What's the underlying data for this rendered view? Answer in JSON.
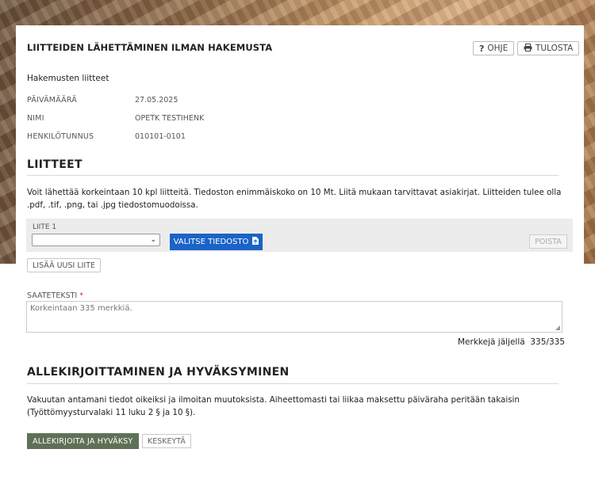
{
  "header": {
    "title": "LIITTEIDEN LÄHETTÄMINEN ILMAN HAKEMUSTA",
    "help_label": "OHJE",
    "help_icon": "?",
    "print_label": "TULOSTA"
  },
  "applicant": {
    "subheading": "Hakemusten liitteet",
    "fields": [
      {
        "label": "PÄIVÄMÄÄRÄ",
        "value": "27.05.2025"
      },
      {
        "label": "NIMI",
        "value": "OPETK TESTIHENK"
      },
      {
        "label": "HENKILÖTUNNUS",
        "value": "010101-0101"
      }
    ]
  },
  "attachments": {
    "title": "LIITTEET",
    "description": "Voit lähettää korkeintaan 10 kpl liitteitä. Tiedoston enimmäiskoko on 10 Mt. Liitä mukaan tarvittavat asiakirjat. Liitteiden tulee olla .pdf, .tif, .png, tai .jpg tiedostomuodoissa.",
    "item_label": "LIITE 1",
    "select_value": "",
    "choose_file_label": "VALITSE TIEDOSTO",
    "remove_label": "POISTA",
    "add_label": "LISÄÄ UUSI LIITE"
  },
  "cover_text": {
    "label": "SAATETEKSTI",
    "required_mark": "*",
    "placeholder": "Korkeintaan 335 merkkiä.",
    "counter_label": "Merkkejä jäljellä",
    "counter_value": "335/335"
  },
  "signing": {
    "title": "ALLEKIRJOITTAMINEN JA HYVÄKSYMINEN",
    "text": "Vakuutan antamani tiedot oikeiksi ja ilmoitan muutoksista. Aiheettomasti tai liikaa maksettu päiväraha peritään takaisin (Työttömyysturvalaki 11 luku 2 § ja 10 §).",
    "approve_label": "ALLEKIRJOITA JA HYVÄKSY",
    "cancel_label": "KESKEYTÄ"
  },
  "colors": {
    "primary_button": "#1a63c7",
    "approve_button": "#5e7157",
    "required": "#d32f2f"
  }
}
